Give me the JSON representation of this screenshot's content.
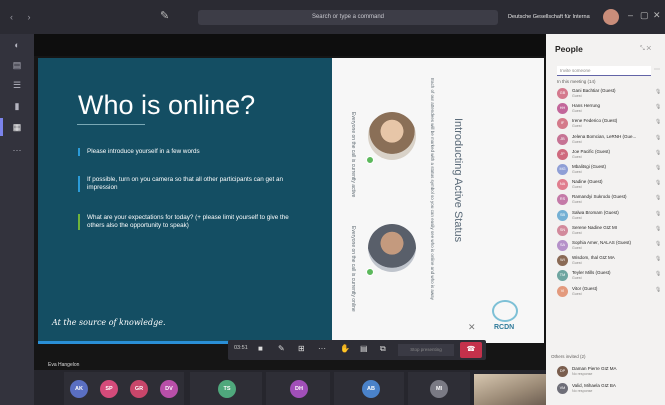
{
  "titlebar": {
    "search_placeholder": "Search or type a command",
    "org_name": "Deutsche Gesellschaft für Internation...",
    "nav_glyphs": "‹ ›",
    "compose_glyph": "✎",
    "min_glyph": "–",
    "max_glyph": "▢",
    "close_glyph": "✕"
  },
  "rail": {
    "items": [
      "◐",
      "▤",
      "☰",
      "▮",
      "▦",
      "···"
    ]
  },
  "slide": {
    "title": "Who is online?",
    "bullets": [
      {
        "text": "Please introduce yourself in a few words",
        "color": "#2b9bd8"
      },
      {
        "text": "If possible, turn on you camera so that all other participants can get an impression",
        "color": "#2b9bd8"
      },
      {
        "text": "What are your expectations for today? (+ please limit yourself to give the others also the opportunity to speak)",
        "color": "#6fb33b"
      }
    ],
    "footer": "At the source of knowledge.",
    "side_title": "Introducting Active Status",
    "side_text": "Each of our attendees will be marked with a status symbol so you can easily see who is online and who is away",
    "caption1": "Everyone on the call is currently active",
    "caption2": "Everyone on the call is currently online",
    "logo_text": "RCDN"
  },
  "callbar": {
    "time": "03:51",
    "buttons": [
      "■",
      "✎",
      "⊞",
      "···",
      "✋",
      "▤",
      "⧉"
    ],
    "stop_label": "Stop presenting",
    "leave_icon": "☎"
  },
  "presenter_name": "Eva Hangelon",
  "participants_row": [
    {
      "initials": "AK",
      "color": "#5a6fc2"
    },
    {
      "initials": "SP",
      "color": "#d44b7a"
    },
    {
      "initials": "GR",
      "color": "#c8466a"
    },
    {
      "initials": "DV",
      "color": "#b84fa8"
    },
    {
      "initials": "TS",
      "color": "#4fa87c"
    },
    {
      "initials": "DH",
      "color": "#a14fb8"
    },
    {
      "initials": "AB",
      "color": "#4a82c9"
    },
    {
      "initials": "MI",
      "color": "#7a7a84"
    }
  ],
  "people_panel": {
    "title": "People",
    "search_placeholder": "Invite someone",
    "section": "In this meeting (14)",
    "people": [
      {
        "name": "Gani Bachtiar (Guest)",
        "role": "Guest",
        "initials": "GB",
        "color": "#d4798d"
      },
      {
        "name": "Hans Herrung",
        "role": "Guest",
        "initials": "HH",
        "color": "#c2669a"
      },
      {
        "name": "Irene Federico (Guest)",
        "role": "Guest",
        "initials": "IF",
        "color": "#d47a8a"
      },
      {
        "name": "Jelena Bomcian, LeRNH (Gue...",
        "role": "Guest",
        "initials": "JB",
        "color": "#c67394"
      },
      {
        "name": "Joe Pacific (Guest)",
        "role": "Guest",
        "initials": "JP",
        "color": "#cf6a7e"
      },
      {
        "name": "Mbalitsgi (Guest)",
        "role": "Guest",
        "initials": "MG",
        "color": "#8f9fd6"
      },
      {
        "name": "Nadine (Guest)",
        "role": "Guest",
        "initials": "NA",
        "color": "#e07e8e"
      },
      {
        "name": "Ramandyi Sukrodo (Guest)",
        "role": "Guest",
        "initials": "RS",
        "color": "#c47aa8"
      },
      {
        "name": "Salwa Bromam (Guest)",
        "role": "Guest",
        "initials": "SB",
        "color": "#74b0d4"
      },
      {
        "name": "Serene Nadine GIZ MI",
        "role": "Guest",
        "initials": "SN",
        "color": "#d28a9c"
      },
      {
        "name": "Sophia Amer, NALAS (Guest)",
        "role": "Guest",
        "initials": "SA",
        "color": "#b591c9"
      },
      {
        "name": "Wisdom, Ihal GIZ MA",
        "role": "Guest",
        "initials": "WI",
        "color": "#8a6a55"
      },
      {
        "name": "Teyler Mills (Guest)",
        "role": "Guest",
        "initials": "TM",
        "color": "#6ea5a0"
      },
      {
        "name": "Vitor (Guest)",
        "role": "Guest",
        "initials": "VI",
        "color": "#e39a7d"
      }
    ],
    "others_label": "Others invited (2)",
    "others": [
      {
        "name": "Daman Pierre GIZ MA",
        "role": "No response",
        "initials": "DP",
        "color": "#7a5e4e"
      },
      {
        "name": "Valid, Mihaela GIZ BA",
        "role": "No response",
        "initials": "VM",
        "color": "#6e6e78"
      }
    ]
  }
}
